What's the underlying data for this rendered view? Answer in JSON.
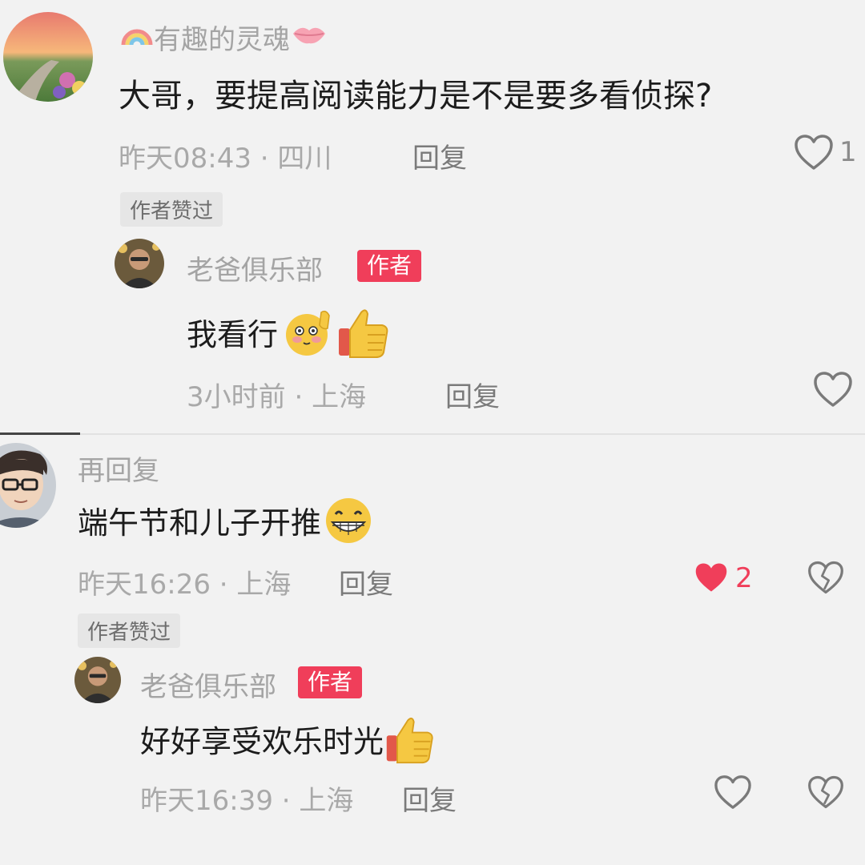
{
  "comments": [
    {
      "user": "有趣的灵魂",
      "text": "大哥，要提高阅读能力是不是要多看侦探?",
      "time": "昨天08:43",
      "location": "四川",
      "reply_label": "回复",
      "likes": "1",
      "author_liked_label": "作者赞过",
      "reply": {
        "user": "老爸俱乐部",
        "badge": "作者",
        "text": "我看行",
        "time": "3小时前",
        "location": "上海",
        "reply_label": "回复"
      }
    },
    {
      "user": "再回复",
      "text": "端午节和儿子开推",
      "time": "昨天16:26",
      "location": "上海",
      "reply_label": "回复",
      "likes": "2",
      "author_liked_label": "作者赞过",
      "reply": {
        "user": "老爸俱乐部",
        "badge": "作者",
        "text": "好好享受欢乐时光",
        "time": "昨天16:39",
        "location": "上海",
        "reply_label": "回复"
      }
    }
  ],
  "icons": {
    "heart": "heart-outline-icon",
    "heart_filled": "heart-filled-icon",
    "dislike": "broken-heart-icon",
    "thumbs_up": "thumbs-up-emoji",
    "shy": "shy-emoji",
    "grin": "grin-emoji",
    "rainbow": "rainbow-emoji",
    "lips": "lips-emoji"
  },
  "colors": {
    "accent": "#f03e5a",
    "muted": "#a9a9a9",
    "background": "#f2f2f2"
  }
}
